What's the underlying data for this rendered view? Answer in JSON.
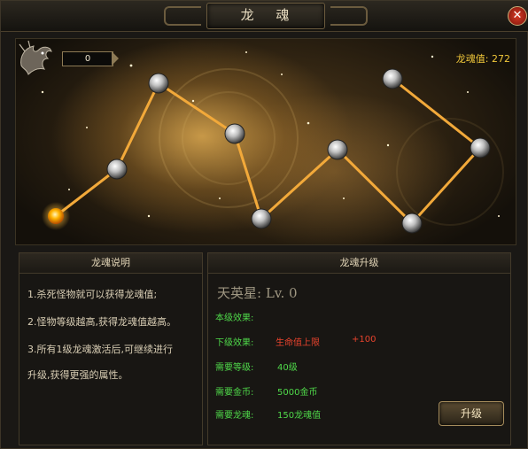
{
  "window": {
    "title": "龙 魂"
  },
  "map": {
    "counter": "0",
    "soul_value": "龙魂值: 272"
  },
  "desc_panel": {
    "title": "龙魂说明",
    "lines": [
      "1.杀死怪物就可以获得龙魂值;",
      "2.怪物等级越高,获得龙魂值越高。",
      "3.所有1级龙魂激活后,可继续进行",
      "升级,获得更强的属性。"
    ]
  },
  "upgrade_panel": {
    "title": "龙魂升级",
    "star_name": "天英星: Lv. 0",
    "current_effect_label": "本级效果:",
    "next_effect_label": "下级效果:",
    "next_effect_stat": "生命值上限",
    "next_effect_amount": "+100",
    "req_level_label": "需要等级:",
    "req_level_value": "40级",
    "req_gold_label": "需要金币:",
    "req_gold_value": "5000金币",
    "req_soul_label": "需要龙魂:",
    "req_soul_value": "150龙魂值",
    "upgrade_button": "升级"
  },
  "colors": {
    "line": "#f2a93a",
    "active_node": "#ffb300",
    "effect_label": "#4fd94a",
    "effect_stat": "#e8432d",
    "soul_value": "#f0c73a"
  }
}
